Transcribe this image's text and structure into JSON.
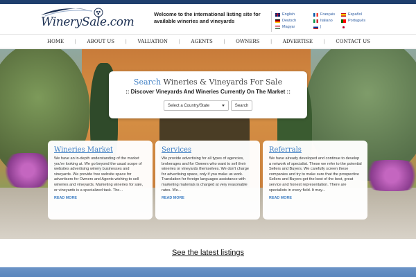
{
  "header": {
    "logo_text": "WinerySale.com",
    "welcome": "Welcome to the international listing site for available wineries and vineyards",
    "languages": [
      {
        "label": "English",
        "flag": "gb-flag-icon"
      },
      {
        "label": "Français",
        "flag": "fr-flag-icon"
      },
      {
        "label": "Español",
        "flag": "es-flag-icon"
      },
      {
        "label": "Deutsch",
        "flag": "de-flag-icon"
      },
      {
        "label": "Italiano",
        "flag": "it-flag-icon"
      },
      {
        "label": "Português",
        "flag": "pt-flag-icon"
      },
      {
        "label": "Magyar",
        "flag": "hu-flag-icon"
      },
      {
        "label": "|",
        "flag": "ru-flag-icon"
      },
      {
        "label": "",
        "flag": "jp-flag-icon"
      }
    ]
  },
  "nav": {
    "items": [
      "HOME",
      "ABOUT US",
      "VALUATION",
      "AGENTS",
      "OWNERS",
      "ADVERTISE",
      "CONTACT US"
    ]
  },
  "search": {
    "title_accent": "Search",
    "title_rest": " Wineries & Vineyards For Sale",
    "subtitle": ":: Discover Vineyards And Wineries Currently On The Market ::",
    "select_value": "Select a Country/State",
    "button_label": "Search"
  },
  "cards": [
    {
      "title": "Wineries Market",
      "body": "We have an in-depth understanding of the market you're looking at. We go beyond the usual scope of websites advertising winery businesses and vineyards. We provide free website space for advertisers for Owners and Agents wishing to sell wineries and vineyards. Marketing wineries for sale, or vineyards is a specialized task. The...",
      "more": "READ MORE"
    },
    {
      "title": "Services",
      "body": "We provide advertising for all types of agencies, brokerages and for Owners who want to sell their wineries or vineyards themselves. We don't charge for advertising space, only if you make us work. Translation for foreign languages assistance with marketing materials is charged at very reasonable rates. We...",
      "more": "READ MORE"
    },
    {
      "title": "Referrals",
      "body": "We have already developed and continue to develop a network of specialist. These we refer to the potential Sellers and Buyers. We carefully screen these companies and try to make sure that the prospective Sellers and Buyers get the best of the best, great service and honest representation. There are specialists in every field. It may...",
      "more": "READ MORE"
    }
  ],
  "latest_link": "See the latest listings",
  "colors": {
    "accent": "#3f7fc4",
    "topbar": "#1f3f6d",
    "footer_band": "#5a86bd"
  }
}
